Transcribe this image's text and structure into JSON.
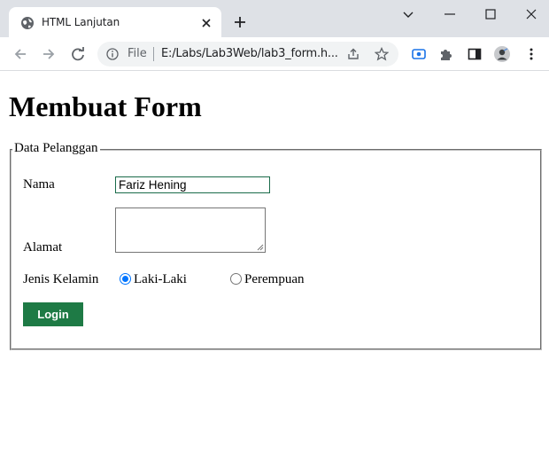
{
  "browser": {
    "tab_title": "HTML Lanjutan",
    "omnibox": {
      "scheme_label": "File",
      "url": "E:/Labs/Lab3Web/lab3_form.h..."
    },
    "icons": {
      "tab": "globe-icon",
      "tab_close": "close-icon",
      "new_tab": "plus-icon",
      "minimize": "minimize-icon",
      "maximize": "maximize-icon",
      "close_window": "close-window-icon",
      "tab_search": "chevron-down-icon",
      "back": "back-arrow-icon",
      "forward": "forward-arrow-icon",
      "reload": "reload-icon",
      "info": "info-icon",
      "share": "share-icon",
      "bookmark": "star-icon",
      "screencast": "cast-icon",
      "extensions": "puzzle-icon",
      "side_panel": "side-panel-icon",
      "profile": "avatar",
      "menu": "kebab-menu-icon"
    },
    "accent_color": "#1a73e8",
    "chrome_color": "#dee1e6"
  },
  "page": {
    "heading": "Membuat Form",
    "fieldset_legend": "Data Pelanggan",
    "form": {
      "name_label": "Nama",
      "name_value": "Fariz Hening",
      "address_label": "Alamat",
      "address_value": "",
      "gender_label": "Jenis Kelamin",
      "gender_options": [
        {
          "label": "Laki-Laki",
          "checked": true
        },
        {
          "label": "Perempuan",
          "checked": false
        }
      ],
      "submit_label": "Login"
    },
    "colors": {
      "button_bg": "#1e7a45",
      "input_border": "#1a6b4a",
      "radio_checked": "#0075ff"
    }
  }
}
